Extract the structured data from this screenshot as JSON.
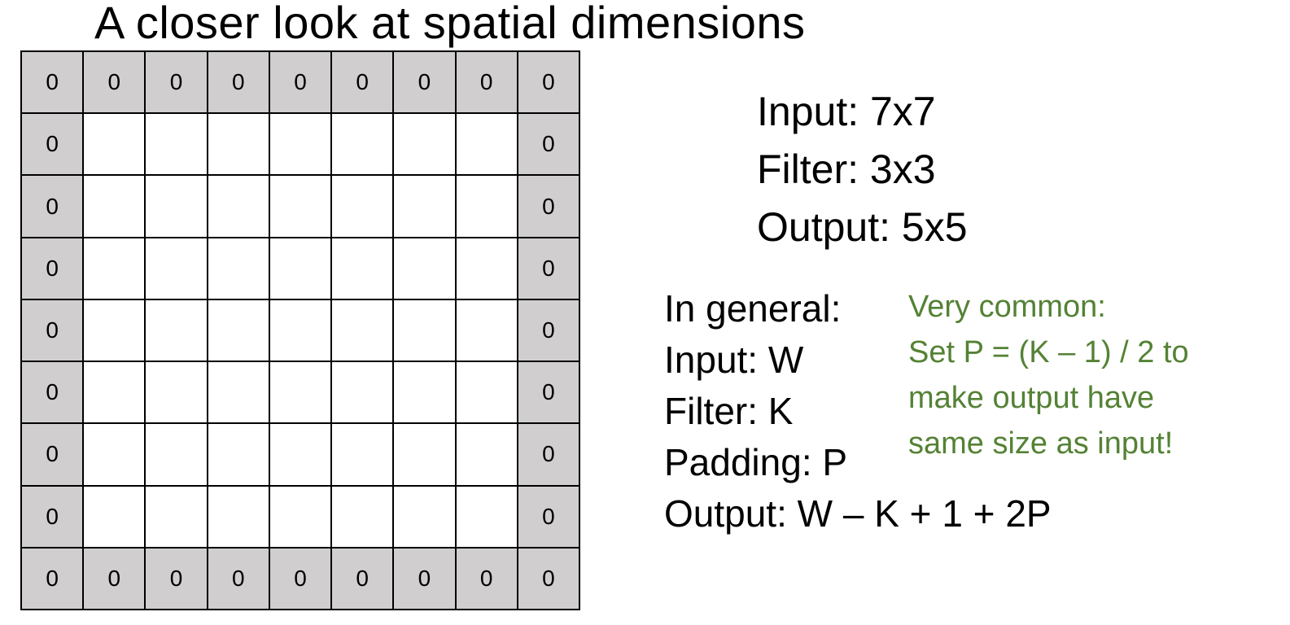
{
  "title": "A closer look at spatial dimensions",
  "grid": {
    "rows": 9,
    "cols": 9,
    "padding_value": "0",
    "padding_color": "#d0cecf"
  },
  "dims": {
    "input": "Input: 7x7",
    "filter": "Filter: 3x3",
    "output": "Output: 5x5"
  },
  "general": {
    "heading": "In general:",
    "input": "Input: W",
    "filter": "Filter: K",
    "padding": "Padding: P",
    "output": "Output: W – K + 1 + 2P"
  },
  "note": {
    "color": "#548235",
    "line1": "Very common:",
    "line2": "Set P = (K – 1) / 2 to",
    "line3": "make output have",
    "line4": "same size as input!"
  }
}
